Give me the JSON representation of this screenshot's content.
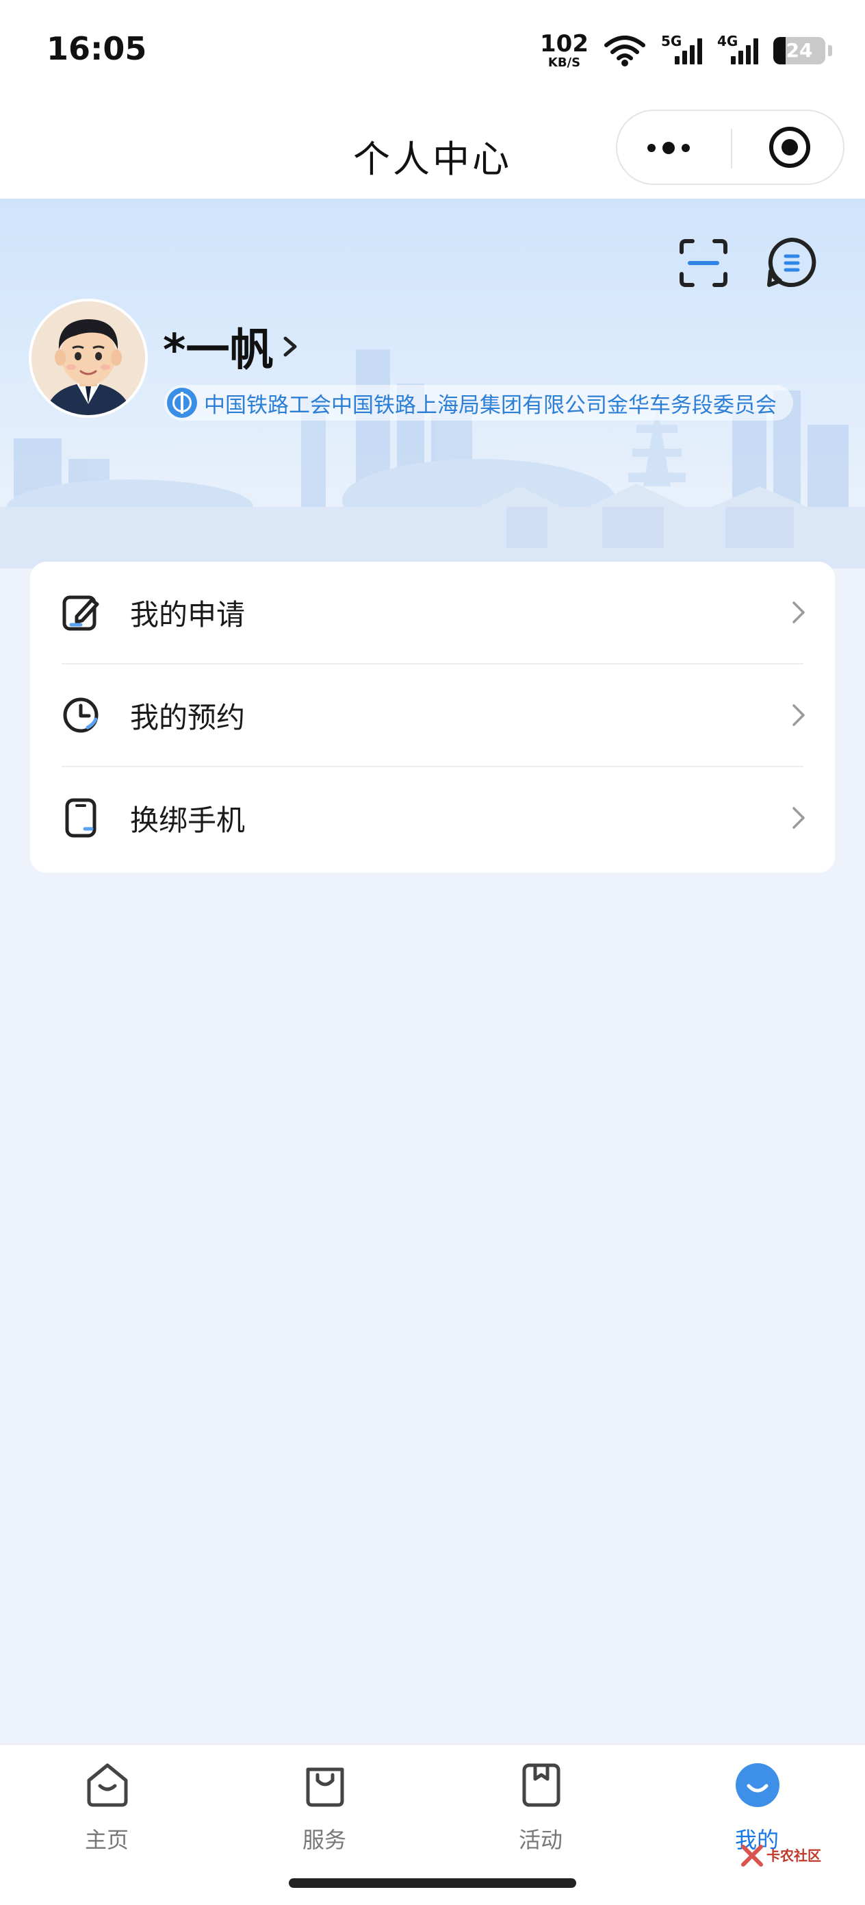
{
  "status_bar": {
    "time": "16:05",
    "net_speed_value": "102",
    "net_speed_unit": "KB/S",
    "signal_1_label": "5G",
    "signal_2_label": "4G",
    "battery_level": "24",
    "battery_fraction": 0.24
  },
  "nav": {
    "title": "个人中心"
  },
  "profile": {
    "name": "*一帆",
    "organization": "中国铁路工会中国铁路上海局集团有限公司金华车务段委员会"
  },
  "menu": {
    "items": [
      {
        "label": "我的申请",
        "icon": "edit-document-icon"
      },
      {
        "label": "我的预约",
        "icon": "clock-icon"
      },
      {
        "label": "换绑手机",
        "icon": "phone-icon"
      }
    ]
  },
  "tabs": [
    {
      "label": "主页",
      "icon": "home-icon",
      "active": false
    },
    {
      "label": "服务",
      "icon": "shopping-bag-icon",
      "active": false
    },
    {
      "label": "活动",
      "icon": "bookmark-icon",
      "active": false
    },
    {
      "label": "我的",
      "icon": "profile-smile-icon",
      "active": true
    }
  ],
  "watermark": {
    "text": "卡农社区"
  },
  "colors": {
    "accent": "#1677e5",
    "org_text": "#2b7fd6",
    "page_bg": "#eef3fb"
  }
}
